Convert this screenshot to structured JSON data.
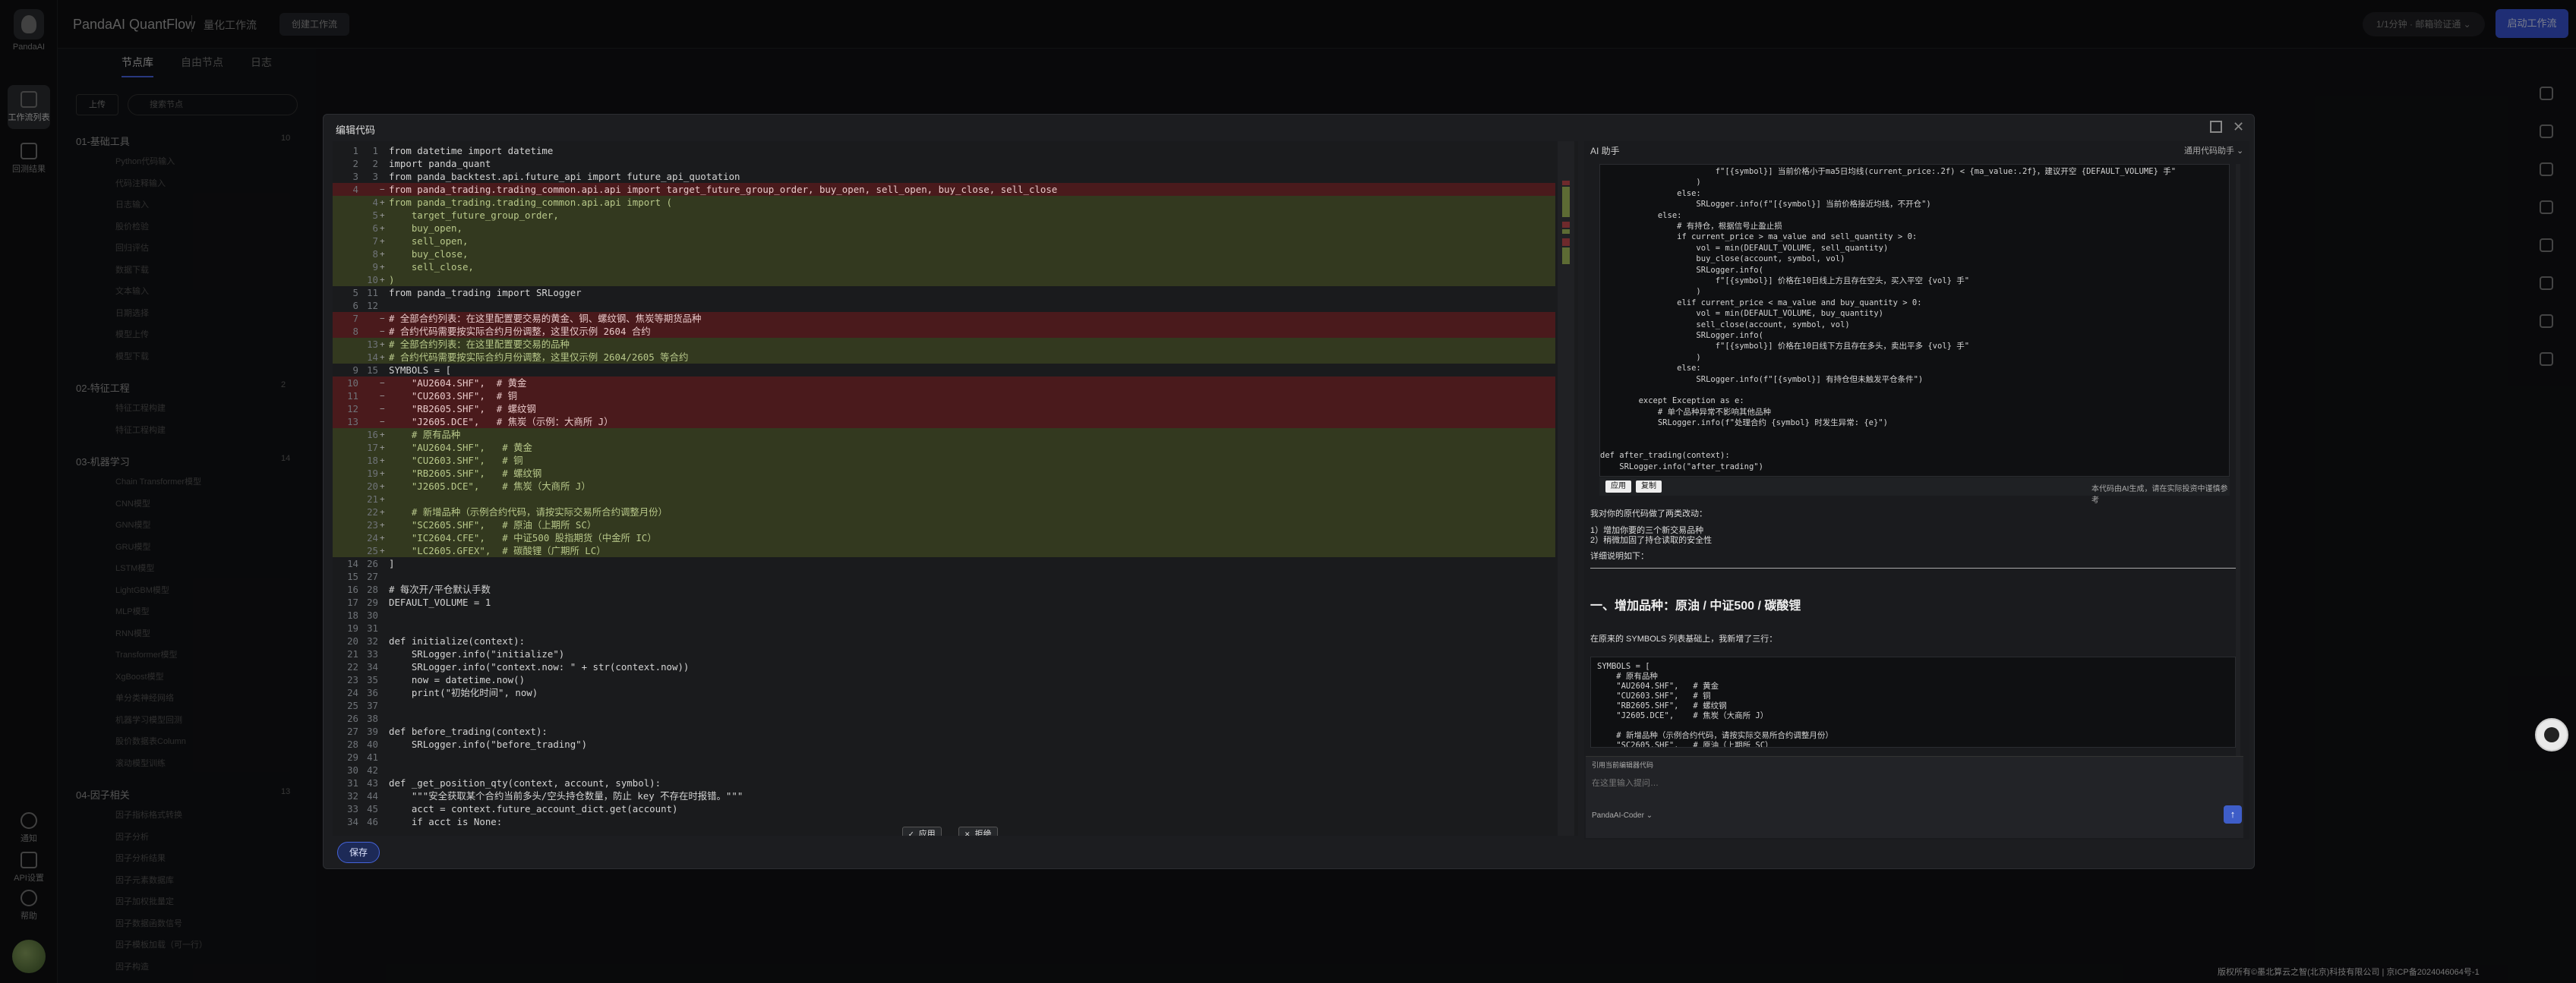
{
  "app": {
    "brand": "PandaAI QuantFlow",
    "subtitle": "量化工作流",
    "logo_label": "PandaAI",
    "ws_button": "创建工作流",
    "top_pill": "1/1分钟 · 邮箱验证通 ⌄",
    "run_button": "启动工作流",
    "footer": "版权所有©墨北算云之智(北京)科技有限公司 | 京ICP备2024046064号-1"
  },
  "rail": {
    "items": [
      {
        "label": "工作流列表"
      },
      {
        "label": "回测结果"
      }
    ],
    "bottom": [
      {
        "label": "通知"
      },
      {
        "label": "API设置"
      },
      {
        "label": "帮助"
      }
    ]
  },
  "nodepanel": {
    "tabs": [
      "节点库",
      "自由节点",
      "日志"
    ],
    "upload": "上传",
    "search_placeholder": "搜索节点",
    "groups": [
      {
        "name": "01-基础工具",
        "count": "10",
        "items": [
          "Python代码输入",
          "代码注释输入",
          "日志输入",
          "股价检验",
          "回归评估",
          "数据下载",
          "文本输入",
          "日期选择",
          "模型上传",
          "模型下载"
        ]
      },
      {
        "name": "02-特征工程",
        "count": "2",
        "items": [
          "特征工程构建",
          "特征工程构建"
        ]
      },
      {
        "name": "03-机器学习",
        "count": "14",
        "items": [
          "Chain Transformer模型",
          "CNN模型",
          "GNN模型",
          "GRU模型",
          "LSTM模型",
          "LightGBM模型",
          "MLP模型",
          "RNN模型",
          "Transformer模型",
          "XgBoost模型",
          "单分类神经网络",
          "机器学习模型回测",
          "股价数据表Column",
          "滚动模型训练"
        ]
      },
      {
        "name": "04-因子相关",
        "count": "13",
        "items": [
          "因子指标格式转换",
          "因子分析",
          "因子分析结果",
          "因子元素数据库",
          "因子加权批量定",
          "因子数据函数信号",
          "因子模板加载（可一行）",
          "因子构造",
          "因子数据过滤"
        ]
      }
    ]
  },
  "modal": {
    "title": "编辑代码",
    "save": "保存",
    "accept": "✓ 应用",
    "reject": "✕ 拒绝"
  },
  "code": [
    {
      "n1": "1",
      "n2": "1",
      "t": "n",
      "s": "from datetime import datetime"
    },
    {
      "n1": "2",
      "n2": "2",
      "t": "n",
      "s": "import panda_quant"
    },
    {
      "n1": "3",
      "n2": "3",
      "t": "n",
      "s": "from panda_backtest.api.future_api import future_api_quotation"
    },
    {
      "n1": "4",
      "n2": "",
      "t": "d",
      "s": "from panda_trading.trading_common.api.api import target_future_group_order, buy_open, sell_open, buy_close, sell_close"
    },
    {
      "n1": "",
      "n2": "4",
      "t": "a",
      "s": "from panda_trading.trading_common.api.api import ("
    },
    {
      "n1": "",
      "n2": "5",
      "t": "a",
      "s": "    target_future_group_order,"
    },
    {
      "n1": "",
      "n2": "6",
      "t": "a",
      "s": "    buy_open,"
    },
    {
      "n1": "",
      "n2": "7",
      "t": "a",
      "s": "    sell_open,"
    },
    {
      "n1": "",
      "n2": "8",
      "t": "a",
      "s": "    buy_close,"
    },
    {
      "n1": "",
      "n2": "9",
      "t": "a",
      "s": "    sell_close,"
    },
    {
      "n1": "",
      "n2": "10",
      "t": "a",
      "s": ")"
    },
    {
      "n1": "5",
      "n2": "11",
      "t": "n",
      "s": "from panda_trading import SRLogger"
    },
    {
      "n1": "6",
      "n2": "12",
      "t": "n",
      "s": ""
    },
    {
      "n1": "7",
      "n2": "",
      "t": "d",
      "s": "# 全部合约列表：在这里配置要交易的黄金、铜、螺纹钢、焦炭等期货品种"
    },
    {
      "n1": "8",
      "n2": "",
      "t": "d",
      "s": "# 合约代码需要按实际合约月份调整，这里仅示例 2604 合约"
    },
    {
      "n1": "",
      "n2": "13",
      "t": "a",
      "s": "# 全部合约列表：在这里配置要交易的品种"
    },
    {
      "n1": "",
      "n2": "14",
      "t": "a",
      "s": "# 合约代码需要按实际合约月份调整，这里仅示例 2604/2605 等合约"
    },
    {
      "n1": "9",
      "n2": "15",
      "t": "n",
      "s": "SYMBOLS = ["
    },
    {
      "n1": "10",
      "n2": "",
      "t": "d",
      "s": "    \"AU2604.SHF\",  # 黄金"
    },
    {
      "n1": "11",
      "n2": "",
      "t": "d",
      "s": "    \"CU2603.SHF\",  # 铜"
    },
    {
      "n1": "12",
      "n2": "",
      "t": "d",
      "s": "    \"RB2605.SHF\",  # 螺纹钢"
    },
    {
      "n1": "13",
      "n2": "",
      "t": "d",
      "s": "    \"J2605.DCE\",   # 焦炭（示例：大商所 J）"
    },
    {
      "n1": "",
      "n2": "16",
      "t": "a",
      "s": "    # 原有品种"
    },
    {
      "n1": "",
      "n2": "17",
      "t": "a",
      "s": "    \"AU2604.SHF\",   # 黄金"
    },
    {
      "n1": "",
      "n2": "18",
      "t": "a",
      "s": "    \"CU2603.SHF\",   # 铜"
    },
    {
      "n1": "",
      "n2": "19",
      "t": "a",
      "s": "    \"RB2605.SHF\",   # 螺纹钢"
    },
    {
      "n1": "",
      "n2": "20",
      "t": "a",
      "s": "    \"J2605.DCE\",    # 焦炭（大商所 J）"
    },
    {
      "n1": "",
      "n2": "21",
      "t": "a",
      "s": ""
    },
    {
      "n1": "",
      "n2": "22",
      "t": "a",
      "s": "    # 新增品种（示例合约代码，请按实际交易所合约调整月份）"
    },
    {
      "n1": "",
      "n2": "23",
      "t": "a",
      "s": "    \"SC2605.SHF\",   # 原油（上期所 SC）"
    },
    {
      "n1": "",
      "n2": "24",
      "t": "a",
      "s": "    \"IC2604.CFE\",   # 中证500 股指期货（中金所 IC）"
    },
    {
      "n1": "",
      "n2": "25",
      "t": "a",
      "s": "    \"LC2605.GFEX\",  # 碳酸锂（广期所 LC）"
    },
    {
      "n1": "14",
      "n2": "26",
      "t": "n",
      "s": "]"
    },
    {
      "n1": "15",
      "n2": "27",
      "t": "n",
      "s": ""
    },
    {
      "n1": "16",
      "n2": "28",
      "t": "n",
      "s": "# 每次开/平仓默认手数"
    },
    {
      "n1": "17",
      "n2": "29",
      "t": "n",
      "s": "DEFAULT_VOLUME = 1"
    },
    {
      "n1": "18",
      "n2": "30",
      "t": "n",
      "s": ""
    },
    {
      "n1": "19",
      "n2": "31",
      "t": "n",
      "s": ""
    },
    {
      "n1": "20",
      "n2": "32",
      "t": "n",
      "s": "def initialize(context):"
    },
    {
      "n1": "21",
      "n2": "33",
      "t": "n",
      "s": "    SRLogger.info(\"initialize\")"
    },
    {
      "n1": "22",
      "n2": "34",
      "t": "n",
      "s": "    SRLogger.info(\"context.now: \" + str(context.now))"
    },
    {
      "n1": "23",
      "n2": "35",
      "t": "n",
      "s": "    now = datetime.now()"
    },
    {
      "n1": "24",
      "n2": "36",
      "t": "n",
      "s": "    print(\"初始化时间\", now)"
    },
    {
      "n1": "25",
      "n2": "37",
      "t": "n",
      "s": ""
    },
    {
      "n1": "26",
      "n2": "38",
      "t": "n",
      "s": ""
    },
    {
      "n1": "27",
      "n2": "39",
      "t": "n",
      "s": "def before_trading(context):"
    },
    {
      "n1": "28",
      "n2": "40",
      "t": "n",
      "s": "    SRLogger.info(\"before_trading\")"
    },
    {
      "n1": "29",
      "n2": "41",
      "t": "n",
      "s": ""
    },
    {
      "n1": "30",
      "n2": "42",
      "t": "n",
      "s": ""
    },
    {
      "n1": "31",
      "n2": "43",
      "t": "n",
      "s": "def _get_position_qty(context, account, symbol):"
    },
    {
      "n1": "32",
      "n2": "44",
      "t": "n",
      "s": "    \"\"\"安全获取某个合约当前多头/空头持仓数量，防止 key 不存在时报错。\"\"\""
    },
    {
      "n1": "33",
      "n2": "45",
      "t": "n",
      "s": "    acct = context.future_account_dict.get(account)"
    },
    {
      "n1": "34",
      "n2": "46",
      "t": "n",
      "s": "    if acct is None:"
    }
  ],
  "ai": {
    "title": "AI 助手",
    "dropdown": "通用代码助手 ⌄",
    "code_lines": [
      "                        f\"[{symbol}] 当前价格小于ma5日均线(current_price:.2f) < {ma_value:.2f}，建议开空 {DEFAULT_VOLUME} 手\"",
      "                    )",
      "                else:",
      "                    SRLogger.info(f\"[{symbol}] 当前价格接近均线，不开仓\")",
      "            else:",
      "                # 有持仓，根据信号止盈止损",
      "                if current_price > ma_value and sell_quantity > 0:",
      "                    vol = min(DEFAULT_VOLUME, sell_quantity)",
      "                    buy_close(account, symbol, vol)",
      "                    SRLogger.info(",
      "                        f\"[{symbol}] 价格在10日线上方且存在空头，买入平空 {vol} 手\"",
      "                    )",
      "                elif current_price < ma_value and buy_quantity > 0:",
      "                    vol = min(DEFAULT_VOLUME, buy_quantity)",
      "                    sell_close(account, symbol, vol)",
      "                    SRLogger.info(",
      "                        f\"[{symbol}] 价格在10日线下方且存在多头，卖出平多 {vol} 手\"",
      "                    )",
      "                else:",
      "                    SRLogger.info(f\"[{symbol}] 有持仓但未触发平仓条件\")",
      "",
      "        except Exception as e:",
      "            # 单个品种异常不影响其他品种",
      "            SRLogger.info(f\"处理合约 {symbol} 时发生异常: {e}\")",
      "",
      "",
      "def after_trading(context):",
      "    SRLogger.info(\"after_trading\")"
    ],
    "apply": "应用",
    "copy": "复制",
    "generated_note": "本代码由AI生成，请在实际投资中谨慎参考",
    "summary": "我对你的原代码做了两类改动：",
    "points": [
      "1）增加你要的三个新交易品种",
      "2）稍微加固了持仓读取的安全性"
    ],
    "detail": "详细说明如下：",
    "h1": "一、增加品种：原油 / 中证500 / 碳酸锂",
    "para": "在原来的 SYMBOLS 列表基础上，我新增了三行：",
    "code2": [
      "SYMBOLS = [",
      "    # 原有品种",
      "    \"AU2604.SHF\",   # 黄金",
      "    \"CU2603.SHF\",   # 铜",
      "    \"RB2605.SHF\",   # 螺纹钢",
      "    \"J2605.DCE\",    # 焦炭（大商所 J）",
      "",
      "    # 新增品种（示例合约代码，请按实际交易所合约调整月份）",
      "    \"SC2605.SHF\",   # 原油（上期所 SC）"
    ],
    "hint": "引用当前编辑器代码",
    "placeholder": "在这里输入提问…",
    "model": "PandaAI-Coder ⌄",
    "send": "↑"
  }
}
